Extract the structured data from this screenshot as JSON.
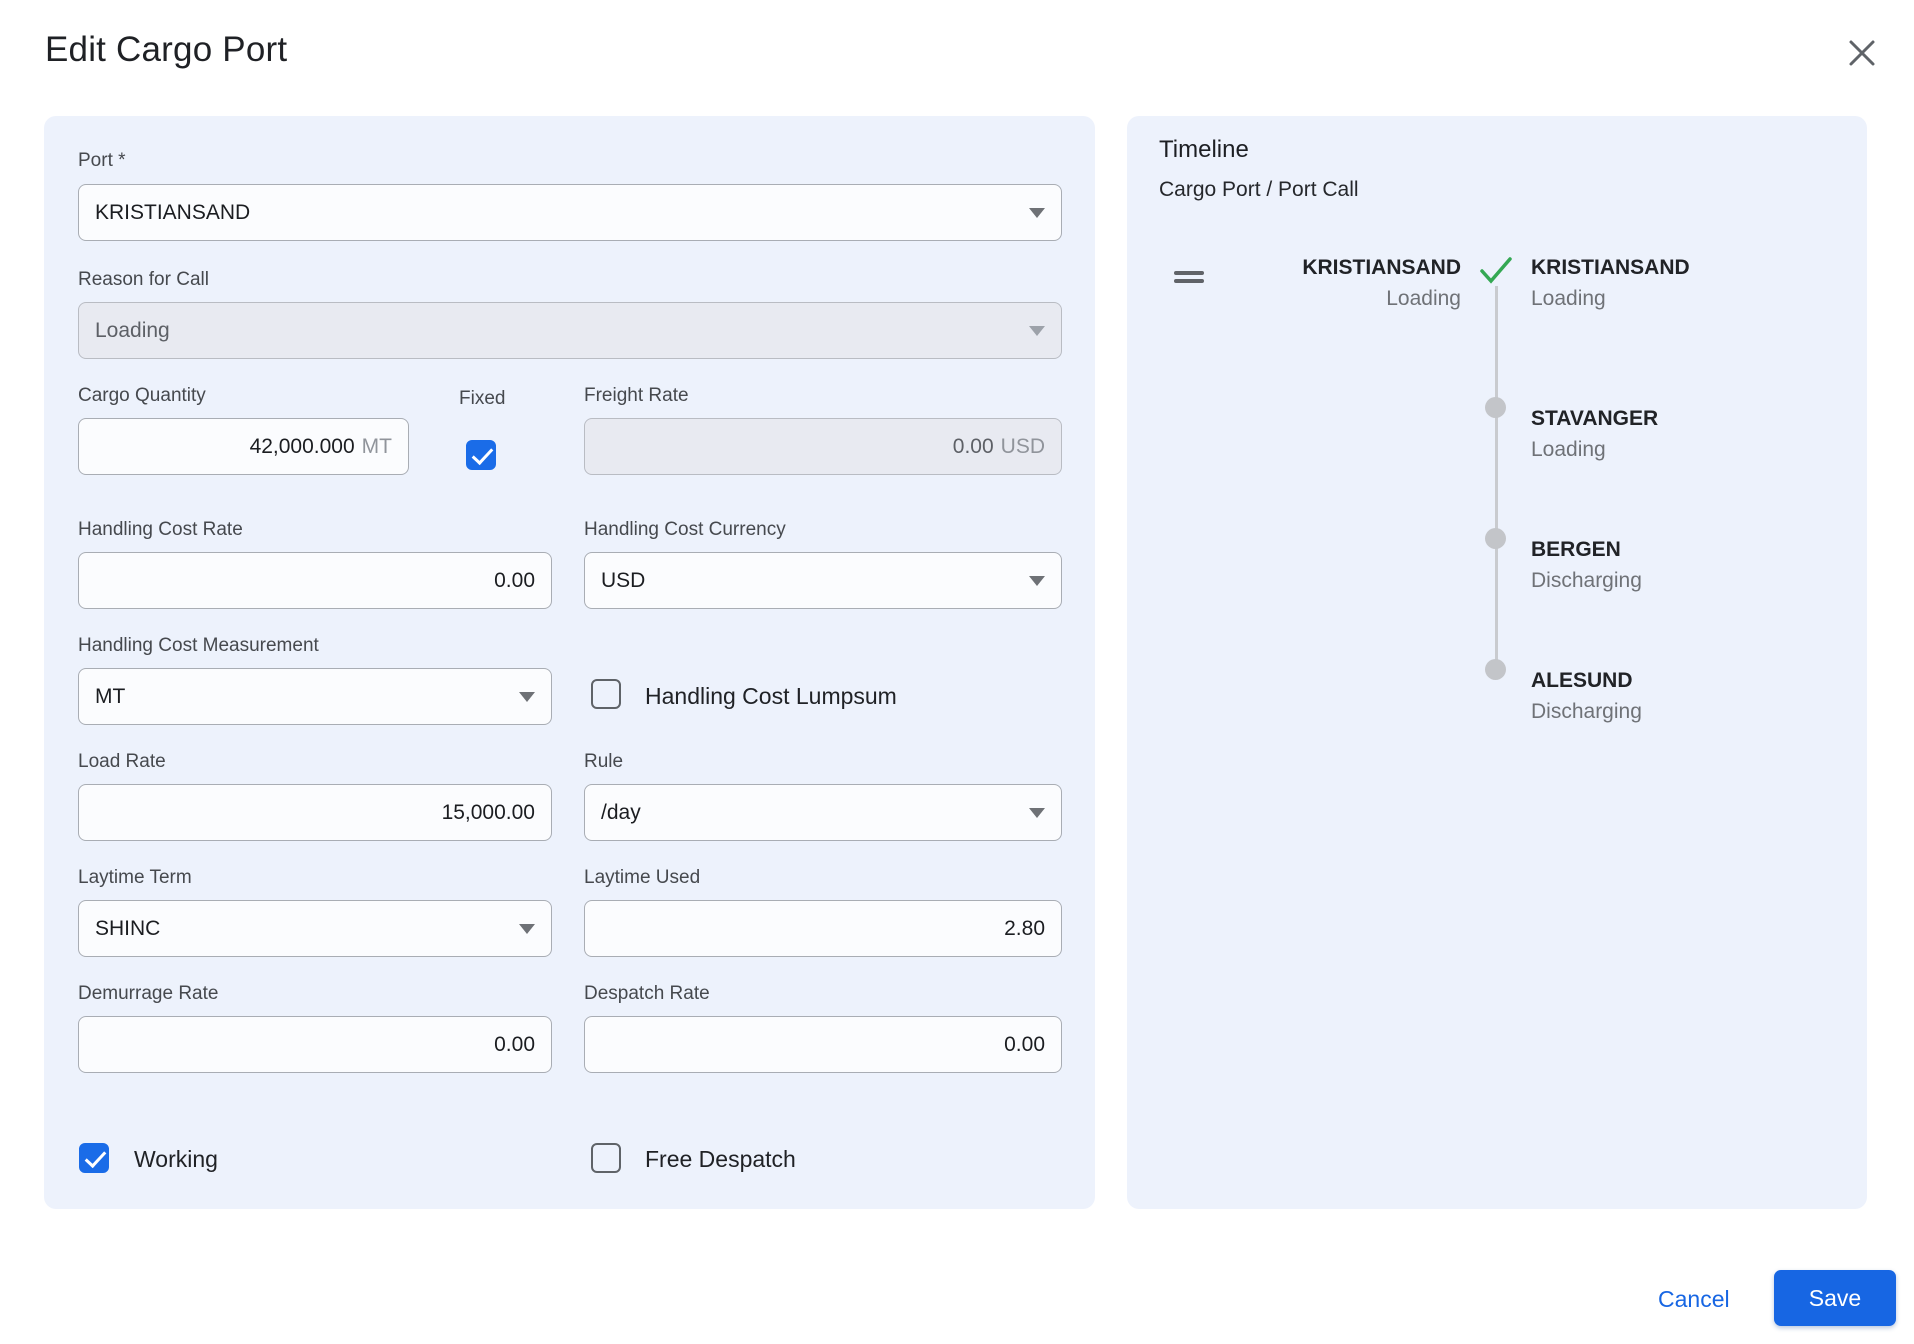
{
  "dialog": {
    "title": "Edit Cargo Port"
  },
  "form": {
    "port": {
      "label": "Port *",
      "value": "KRISTIANSAND"
    },
    "reason_for_call": {
      "label": "Reason for Call",
      "value": "Loading",
      "disabled": true
    },
    "cargo_quantity": {
      "label": "Cargo Quantity",
      "value": "42,000.000",
      "unit": "MT"
    },
    "fixed": {
      "label": "Fixed",
      "checked": true
    },
    "freight_rate": {
      "label": "Freight Rate",
      "value": "0.00",
      "unit": "USD",
      "disabled": true
    },
    "handling_cost_rate": {
      "label": "Handling Cost Rate",
      "value": "0.00"
    },
    "handling_cost_currency": {
      "label": "Handling Cost Currency",
      "value": "USD"
    },
    "handling_cost_measurement": {
      "label": "Handling Cost Measurement",
      "value": "MT"
    },
    "handling_cost_lumpsum": {
      "label": "Handling Cost Lumpsum",
      "checked": false
    },
    "load_rate": {
      "label": "Load Rate",
      "value": "15,000.00"
    },
    "rule": {
      "label": "Rule",
      "value": "/day"
    },
    "laytime_term": {
      "label": "Laytime Term",
      "value": "SHINC"
    },
    "laytime_used": {
      "label": "Laytime Used",
      "value": "2.80"
    },
    "demurrage_rate": {
      "label": "Demurrage Rate",
      "value": "0.00"
    },
    "despatch_rate": {
      "label": "Despatch Rate",
      "value": "0.00"
    },
    "working": {
      "label": "Working",
      "checked": true
    },
    "free_despatch": {
      "label": "Free Despatch",
      "checked": false
    }
  },
  "timeline": {
    "title": "Timeline",
    "subtitle": "Cargo Port / Port Call",
    "items": [
      {
        "port": "KRISTIANSAND",
        "call": "Loading",
        "state": "current"
      },
      {
        "port": "STAVANGER",
        "call": "Loading",
        "state": "upcoming"
      },
      {
        "port": "BERGEN",
        "call": "Discharging",
        "state": "upcoming"
      },
      {
        "port": "ALESUND",
        "call": "Discharging",
        "state": "upcoming"
      }
    ]
  },
  "footer": {
    "cancel_label": "Cancel",
    "save_label": "Save"
  },
  "icons": {
    "close": "close-icon",
    "dropdown": "chevron-down-icon",
    "check": "check-icon",
    "drag": "drag-handle-icon"
  },
  "colors": {
    "accent_blue": "#1766e3",
    "checkbox_blue": "#1a6ce8",
    "panel_bg": "#edf2fc",
    "check_green": "#34a853"
  }
}
